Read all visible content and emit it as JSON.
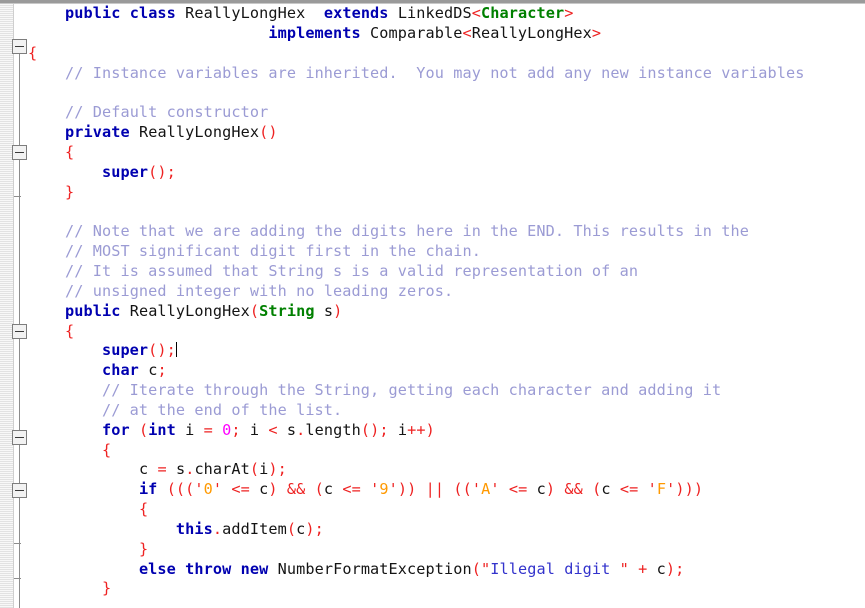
{
  "editor": {
    "language": "Java",
    "class_name": "ReallyLongHex",
    "theme": {
      "background": "#ffffff",
      "keyword": "#0000b0",
      "type": "#008000",
      "identifier": "#141414",
      "comment": "#9b9bd4",
      "punctuation": "#ee2222",
      "number": "#ff00ff",
      "character_literal": "#ff9900",
      "string": "#3333cc",
      "gutter_background": "#f4f4f4",
      "fold_rail": "#8c8c8c"
    },
    "caret": {
      "line_index": 16,
      "after_text": "super();"
    },
    "gutter": {
      "fold_boxes": [
        46,
        152,
        331,
        437,
        490
      ],
      "fold_ticks": [
        196,
        543,
        578
      ]
    }
  },
  "code_lines": [
    {
      "index": 0,
      "tokens": [
        {
          "text": "    ",
          "kind": "plain"
        },
        {
          "text": "public",
          "kind": "kw"
        },
        {
          "text": " ",
          "kind": "plain"
        },
        {
          "text": "class",
          "kind": "kw"
        },
        {
          "text": " ",
          "kind": "plain"
        },
        {
          "text": "ReallyLongHex",
          "kind": "id"
        },
        {
          "text": "  ",
          "kind": "plain"
        },
        {
          "text": "extends",
          "kind": "kw"
        },
        {
          "text": " ",
          "kind": "plain"
        },
        {
          "text": "LinkedDS",
          "kind": "id"
        },
        {
          "text": "<",
          "kind": "punc"
        },
        {
          "text": "Character",
          "kind": "type"
        },
        {
          "text": ">",
          "kind": "punc"
        }
      ]
    },
    {
      "index": 1,
      "tokens": [
        {
          "text": "                          ",
          "kind": "plain"
        },
        {
          "text": "implements",
          "kind": "kw"
        },
        {
          "text": " ",
          "kind": "plain"
        },
        {
          "text": "Comparable",
          "kind": "id"
        },
        {
          "text": "<",
          "kind": "punc"
        },
        {
          "text": "ReallyLongHex",
          "kind": "id"
        },
        {
          "text": ">",
          "kind": "punc"
        }
      ]
    },
    {
      "index": 2,
      "tokens": [
        {
          "text": "{",
          "kind": "punc"
        }
      ]
    },
    {
      "index": 3,
      "tokens": [
        {
          "text": "    ",
          "kind": "plain"
        },
        {
          "text": "// Instance variables are inherited.  You may not add any new instance variables",
          "kind": "com"
        }
      ]
    },
    {
      "index": 4,
      "tokens": []
    },
    {
      "index": 5,
      "tokens": [
        {
          "text": "    ",
          "kind": "plain"
        },
        {
          "text": "// Default constructor",
          "kind": "com"
        }
      ]
    },
    {
      "index": 6,
      "tokens": [
        {
          "text": "    ",
          "kind": "plain"
        },
        {
          "text": "private",
          "kind": "kw"
        },
        {
          "text": " ",
          "kind": "plain"
        },
        {
          "text": "ReallyLongHex",
          "kind": "id"
        },
        {
          "text": "()",
          "kind": "punc"
        }
      ]
    },
    {
      "index": 7,
      "tokens": [
        {
          "text": "    ",
          "kind": "plain"
        },
        {
          "text": "{",
          "kind": "punc"
        }
      ]
    },
    {
      "index": 8,
      "tokens": [
        {
          "text": "        ",
          "kind": "plain"
        },
        {
          "text": "super",
          "kind": "kw"
        },
        {
          "text": "();",
          "kind": "punc"
        }
      ]
    },
    {
      "index": 9,
      "tokens": [
        {
          "text": "    ",
          "kind": "plain"
        },
        {
          "text": "}",
          "kind": "punc"
        }
      ]
    },
    {
      "index": 10,
      "tokens": []
    },
    {
      "index": 11,
      "tokens": [
        {
          "text": "    ",
          "kind": "plain"
        },
        {
          "text": "// Note that we are adding the digits here in the END. This results in the",
          "kind": "com"
        }
      ]
    },
    {
      "index": 12,
      "tokens": [
        {
          "text": "    ",
          "kind": "plain"
        },
        {
          "text": "// MOST significant digit first in the chain.",
          "kind": "com"
        }
      ]
    },
    {
      "index": 13,
      "tokens": [
        {
          "text": "    ",
          "kind": "plain"
        },
        {
          "text": "// It is assumed that String s is a valid representation of an",
          "kind": "com"
        }
      ]
    },
    {
      "index": 14,
      "tokens": [
        {
          "text": "    ",
          "kind": "plain"
        },
        {
          "text": "// unsigned integer with no leading zeros.",
          "kind": "com"
        }
      ]
    },
    {
      "index": 15,
      "tokens": [
        {
          "text": "    ",
          "kind": "plain"
        },
        {
          "text": "public",
          "kind": "kw"
        },
        {
          "text": " ",
          "kind": "plain"
        },
        {
          "text": "ReallyLongHex",
          "kind": "id"
        },
        {
          "text": "(",
          "kind": "punc"
        },
        {
          "text": "String",
          "kind": "type"
        },
        {
          "text": " ",
          "kind": "plain"
        },
        {
          "text": "s",
          "kind": "id"
        },
        {
          "text": ")",
          "kind": "punc"
        }
      ]
    },
    {
      "index": 16,
      "tokens": [
        {
          "text": "    ",
          "kind": "plain"
        },
        {
          "text": "{",
          "kind": "punc"
        }
      ]
    },
    {
      "index": 17,
      "tokens": [
        {
          "text": "        ",
          "kind": "plain"
        },
        {
          "text": "super",
          "kind": "kw"
        },
        {
          "text": "();",
          "kind": "punc"
        },
        {
          "text": "",
          "kind": "caret"
        }
      ]
    },
    {
      "index": 18,
      "tokens": [
        {
          "text": "        ",
          "kind": "plain"
        },
        {
          "text": "char",
          "kind": "kw"
        },
        {
          "text": " ",
          "kind": "plain"
        },
        {
          "text": "c",
          "kind": "id"
        },
        {
          "text": ";",
          "kind": "punc"
        }
      ]
    },
    {
      "index": 19,
      "tokens": [
        {
          "text": "        ",
          "kind": "plain"
        },
        {
          "text": "// Iterate through the String, getting each character and adding it",
          "kind": "com"
        }
      ]
    },
    {
      "index": 20,
      "tokens": [
        {
          "text": "        ",
          "kind": "plain"
        },
        {
          "text": "// at the end of the list.",
          "kind": "com"
        }
      ]
    },
    {
      "index": 21,
      "tokens": [
        {
          "text": "        ",
          "kind": "plain"
        },
        {
          "text": "for",
          "kind": "kw"
        },
        {
          "text": " ",
          "kind": "plain"
        },
        {
          "text": "(",
          "kind": "punc"
        },
        {
          "text": "int",
          "kind": "kw"
        },
        {
          "text": " ",
          "kind": "plain"
        },
        {
          "text": "i",
          "kind": "id"
        },
        {
          "text": " ",
          "kind": "plain"
        },
        {
          "text": "=",
          "kind": "punc"
        },
        {
          "text": " ",
          "kind": "plain"
        },
        {
          "text": "0",
          "kind": "num"
        },
        {
          "text": ";",
          "kind": "punc"
        },
        {
          "text": " ",
          "kind": "plain"
        },
        {
          "text": "i",
          "kind": "id"
        },
        {
          "text": " ",
          "kind": "plain"
        },
        {
          "text": "<",
          "kind": "punc"
        },
        {
          "text": " ",
          "kind": "plain"
        },
        {
          "text": "s",
          "kind": "id"
        },
        {
          "text": ".",
          "kind": "punc"
        },
        {
          "text": "length",
          "kind": "id"
        },
        {
          "text": "();",
          "kind": "punc"
        },
        {
          "text": " ",
          "kind": "plain"
        },
        {
          "text": "i",
          "kind": "id"
        },
        {
          "text": "++)",
          "kind": "punc"
        }
      ]
    },
    {
      "index": 22,
      "tokens": [
        {
          "text": "        ",
          "kind": "plain"
        },
        {
          "text": "{",
          "kind": "punc"
        }
      ]
    },
    {
      "index": 23,
      "tokens": [
        {
          "text": "            ",
          "kind": "plain"
        },
        {
          "text": "c",
          "kind": "id"
        },
        {
          "text": " ",
          "kind": "plain"
        },
        {
          "text": "=",
          "kind": "punc"
        },
        {
          "text": " ",
          "kind": "plain"
        },
        {
          "text": "s",
          "kind": "id"
        },
        {
          "text": ".",
          "kind": "punc"
        },
        {
          "text": "charAt",
          "kind": "id"
        },
        {
          "text": "(",
          "kind": "punc"
        },
        {
          "text": "i",
          "kind": "id"
        },
        {
          "text": ");",
          "kind": "punc"
        }
      ]
    },
    {
      "index": 24,
      "tokens": [
        {
          "text": "            ",
          "kind": "plain"
        },
        {
          "text": "if",
          "kind": "kw"
        },
        {
          "text": " ",
          "kind": "plain"
        },
        {
          "text": "(((",
          "kind": "punc"
        },
        {
          "text": "'",
          "kind": "punc"
        },
        {
          "text": "0",
          "kind": "char"
        },
        {
          "text": "'",
          "kind": "punc"
        },
        {
          "text": " ",
          "kind": "plain"
        },
        {
          "text": "<=",
          "kind": "punc"
        },
        {
          "text": " ",
          "kind": "plain"
        },
        {
          "text": "c",
          "kind": "id"
        },
        {
          "text": ")",
          "kind": "punc"
        },
        {
          "text": " ",
          "kind": "plain"
        },
        {
          "text": "&&",
          "kind": "punc"
        },
        {
          "text": " ",
          "kind": "plain"
        },
        {
          "text": "(",
          "kind": "punc"
        },
        {
          "text": "c",
          "kind": "id"
        },
        {
          "text": " ",
          "kind": "plain"
        },
        {
          "text": "<=",
          "kind": "punc"
        },
        {
          "text": " ",
          "kind": "plain"
        },
        {
          "text": "'",
          "kind": "punc"
        },
        {
          "text": "9",
          "kind": "char"
        },
        {
          "text": "'",
          "kind": "punc"
        },
        {
          "text": "))",
          "kind": "punc"
        },
        {
          "text": " ",
          "kind": "plain"
        },
        {
          "text": "||",
          "kind": "punc"
        },
        {
          "text": " ",
          "kind": "plain"
        },
        {
          "text": "((",
          "kind": "punc"
        },
        {
          "text": "'",
          "kind": "punc"
        },
        {
          "text": "A",
          "kind": "char"
        },
        {
          "text": "'",
          "kind": "punc"
        },
        {
          "text": " ",
          "kind": "plain"
        },
        {
          "text": "<=",
          "kind": "punc"
        },
        {
          "text": " ",
          "kind": "plain"
        },
        {
          "text": "c",
          "kind": "id"
        },
        {
          "text": ")",
          "kind": "punc"
        },
        {
          "text": " ",
          "kind": "plain"
        },
        {
          "text": "&&",
          "kind": "punc"
        },
        {
          "text": " ",
          "kind": "plain"
        },
        {
          "text": "(",
          "kind": "punc"
        },
        {
          "text": "c",
          "kind": "id"
        },
        {
          "text": " ",
          "kind": "plain"
        },
        {
          "text": "<=",
          "kind": "punc"
        },
        {
          "text": " ",
          "kind": "plain"
        },
        {
          "text": "'",
          "kind": "punc"
        },
        {
          "text": "F",
          "kind": "char"
        },
        {
          "text": "'",
          "kind": "punc"
        },
        {
          "text": ")))",
          "kind": "punc"
        }
      ]
    },
    {
      "index": 25,
      "tokens": [
        {
          "text": "            ",
          "kind": "plain"
        },
        {
          "text": "{",
          "kind": "punc"
        }
      ]
    },
    {
      "index": 26,
      "tokens": [
        {
          "text": "                ",
          "kind": "plain"
        },
        {
          "text": "this",
          "kind": "kw"
        },
        {
          "text": ".",
          "kind": "punc"
        },
        {
          "text": "addItem",
          "kind": "id"
        },
        {
          "text": "(",
          "kind": "punc"
        },
        {
          "text": "c",
          "kind": "id"
        },
        {
          "text": ");",
          "kind": "punc"
        }
      ]
    },
    {
      "index": 27,
      "tokens": [
        {
          "text": "            ",
          "kind": "plain"
        },
        {
          "text": "}",
          "kind": "punc"
        }
      ]
    },
    {
      "index": 28,
      "tokens": [
        {
          "text": "            ",
          "kind": "plain"
        },
        {
          "text": "else",
          "kind": "kw"
        },
        {
          "text": " ",
          "kind": "plain"
        },
        {
          "text": "throw",
          "kind": "kw"
        },
        {
          "text": " ",
          "kind": "plain"
        },
        {
          "text": "new",
          "kind": "kw"
        },
        {
          "text": " ",
          "kind": "plain"
        },
        {
          "text": "NumberFormatException",
          "kind": "id"
        },
        {
          "text": "(",
          "kind": "punc"
        },
        {
          "text": "\"",
          "kind": "punc"
        },
        {
          "text": "Illegal digit ",
          "kind": "str"
        },
        {
          "text": "\"",
          "kind": "punc"
        },
        {
          "text": " ",
          "kind": "plain"
        },
        {
          "text": "+",
          "kind": "punc"
        },
        {
          "text": " ",
          "kind": "plain"
        },
        {
          "text": "c",
          "kind": "id"
        },
        {
          "text": ");",
          "kind": "punc"
        }
      ]
    },
    {
      "index": 29,
      "tokens": [
        {
          "text": "        ",
          "kind": "plain"
        },
        {
          "text": "}",
          "kind": "punc"
        }
      ]
    }
  ]
}
